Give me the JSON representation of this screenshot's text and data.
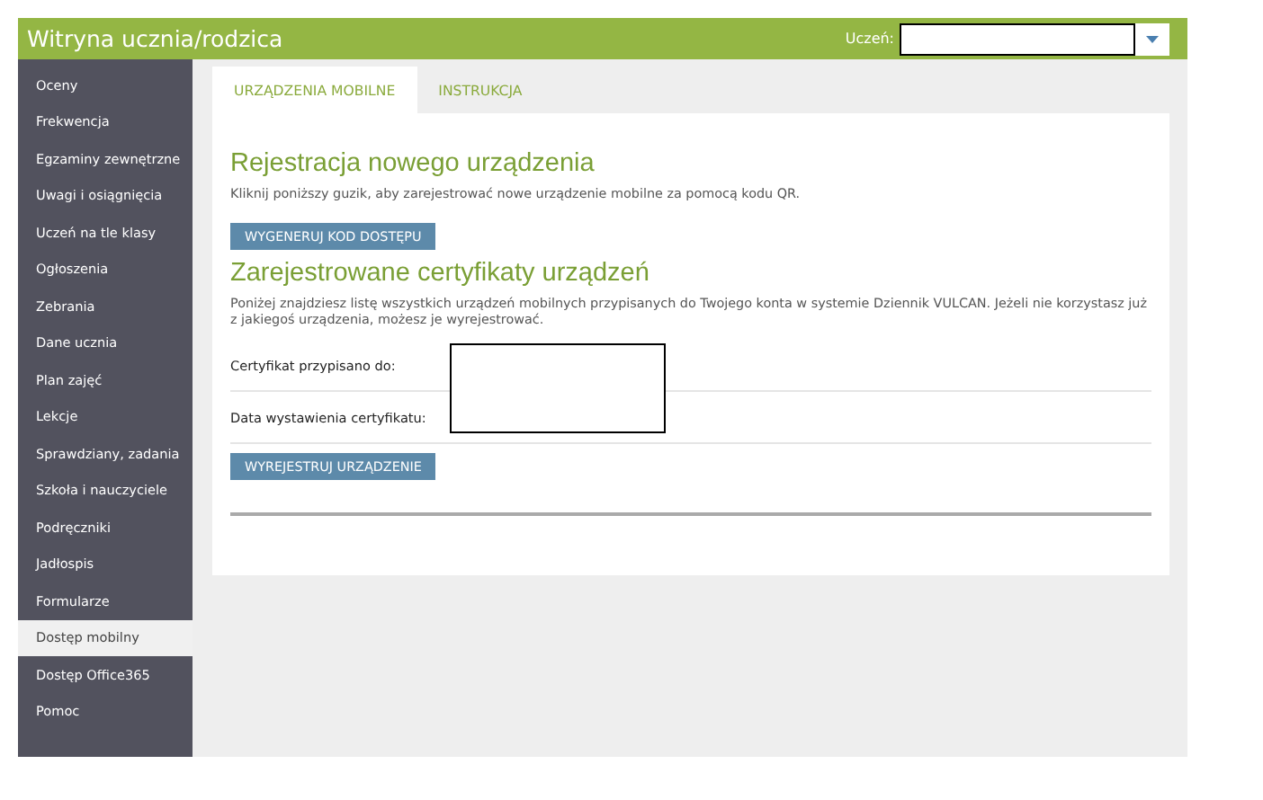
{
  "header": {
    "title": "Witryna ucznia/rodzica",
    "student_label": "Uczeń:"
  },
  "sidebar": {
    "items": [
      {
        "label": "Oceny",
        "selected": false
      },
      {
        "label": "Frekwencja",
        "selected": false
      },
      {
        "label": "Egzaminy zewnętrzne",
        "selected": false
      },
      {
        "label": "Uwagi i osiągnięcia",
        "selected": false
      },
      {
        "label": "Uczeń na tle klasy",
        "selected": false
      },
      {
        "label": "Ogłoszenia",
        "selected": false
      },
      {
        "label": "Zebrania",
        "selected": false
      },
      {
        "label": "Dane ucznia",
        "selected": false
      },
      {
        "label": "Plan zajęć",
        "selected": false
      },
      {
        "label": "Lekcje",
        "selected": false
      },
      {
        "label": "Sprawdziany, zadania",
        "selected": false
      },
      {
        "label": "Szkoła i nauczyciele",
        "selected": false
      },
      {
        "label": "Podręczniki",
        "selected": false
      },
      {
        "label": "Jadłospis",
        "selected": false
      },
      {
        "label": "Formularze",
        "selected": false
      },
      {
        "label": "Dostęp mobilny",
        "selected": true
      },
      {
        "label": "Dostęp Office365",
        "selected": false
      },
      {
        "label": "Pomoc",
        "selected": false
      }
    ]
  },
  "tabs": [
    {
      "label": "URZĄDZENIA MOBILNE",
      "selected": true
    },
    {
      "label": "INSTRUKCJA",
      "selected": false
    }
  ],
  "registration": {
    "heading": "Rejestracja nowego urządzenia",
    "text": "Kliknij poniższy guzik, aby zarejestrować nowe urządzenie mobilne za pomocą kodu QR.",
    "button": "WYGENERUJ KOD DOSTĘPU"
  },
  "certificates": {
    "heading": "Zarejestrowane certyfikaty urządzeń",
    "text": "Poniżej znajdziesz listę wszystkich urządzeń mobilnych przypisanych do Twojego konta w systemie Dziennik VULCAN. Jeżeli nie korzystasz już z jakiegoś urządzenia, możesz je wyrejestrować.",
    "fields": [
      {
        "label": "Certyfikat przypisano do:"
      },
      {
        "label": "Data wystawienia certyfikatu:"
      }
    ],
    "button": "WYREJESTRUJ URZĄDZENIE"
  }
}
